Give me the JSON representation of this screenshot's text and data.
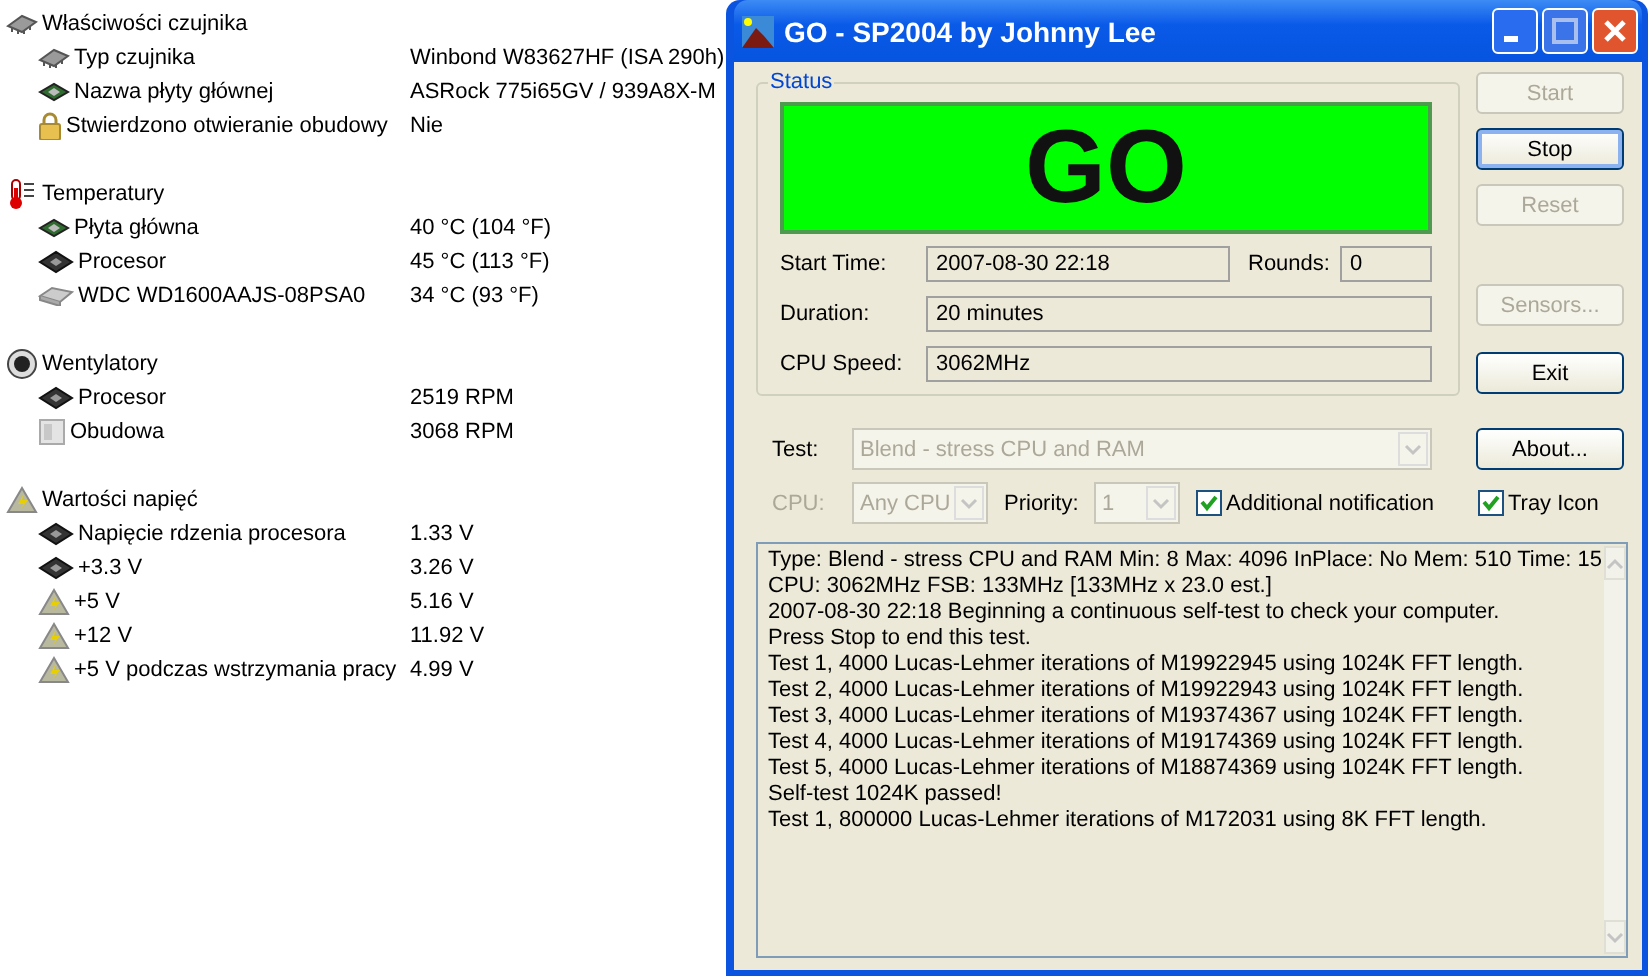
{
  "sensor_panel": {
    "sections": [
      {
        "title": "Właściwości czujnika",
        "kind": "chip",
        "items": [
          {
            "label": "Typ czujnika",
            "value": "Winbond W83627HF  (ISA 290h)",
            "kind": "chip"
          },
          {
            "label": "Nazwa płyty głównej",
            "value": "ASRock 775i65GV / 939A8X-M",
            "kind": "board"
          },
          {
            "label": "Stwierdzono otwieranie obudowy",
            "value": "Nie",
            "kind": "lock"
          }
        ]
      },
      {
        "title": "Temperatury",
        "kind": "thermo",
        "items": [
          {
            "label": "Płyta główna",
            "value": "40 °C  (104 °F)",
            "kind": "board"
          },
          {
            "label": "Procesor",
            "value": "45 °C  (113 °F)",
            "kind": "cpu"
          },
          {
            "label": "WDC WD1600AAJS-08PSA0",
            "value": "34 °C  (93 °F)",
            "kind": "disk"
          }
        ]
      },
      {
        "title": "Wentylatory",
        "kind": "fan",
        "items": [
          {
            "label": "Procesor",
            "value": "2519 RPM",
            "kind": "cpu"
          },
          {
            "label": "Obudowa",
            "value": "3068 RPM",
            "kind": "case"
          }
        ]
      },
      {
        "title": "Wartości napięć",
        "kind": "volt",
        "items": [
          {
            "label": "Napięcie rdzenia procesora",
            "value": "1.33 V",
            "kind": "cpu"
          },
          {
            "label": "+3.3 V",
            "value": "3.26 V",
            "kind": "cpu"
          },
          {
            "label": "+5 V",
            "value": "5.16 V",
            "kind": "volt"
          },
          {
            "label": "+12 V",
            "value": "11.92 V",
            "kind": "volt"
          },
          {
            "label": "+5 V podczas wstrzymania pracy",
            "value": "4.99 V",
            "kind": "volt"
          }
        ]
      }
    ]
  },
  "window": {
    "title": "GO - SP2004 by Johnny Lee",
    "status": {
      "legend": "Status",
      "indicator": "GO",
      "start_time": {
        "label": "Start Time:",
        "value": "2007-08-30 22:18"
      },
      "rounds": {
        "label": "Rounds:",
        "value": "0"
      },
      "duration": {
        "label": "Duration:",
        "value": "20 minutes"
      },
      "cpu_speed": {
        "label": "CPU Speed:",
        "value": "3062MHz"
      }
    },
    "buttons": [
      {
        "label": "Start",
        "disabled": true,
        "focused": false
      },
      {
        "label": "Stop",
        "disabled": false,
        "focused": true
      },
      {
        "label": "Reset",
        "disabled": true,
        "focused": false
      },
      {
        "label": "Sensors...",
        "disabled": true,
        "focused": false
      },
      {
        "label": "Exit",
        "disabled": false,
        "focused": false
      }
    ],
    "about_button": {
      "label": "About...",
      "disabled": false
    },
    "test": {
      "label": "Test:",
      "value": "Blend - stress CPU and RAM",
      "disabled": true
    },
    "cpu": {
      "label": "CPU:",
      "value": "Any CPU",
      "disabled": true
    },
    "priority": {
      "label": "Priority:",
      "value": "1",
      "disabled": true
    },
    "additional_notification": {
      "label": "Additional notification",
      "checked": true
    },
    "tray_icon": {
      "label": "Tray Icon",
      "checked": true
    },
    "log": [
      "Type: Blend - stress CPU and RAM Min: 8 Max: 4096 InPlace: No Mem: 510 Time: 15",
      "CPU: 3062MHz FSB: 133MHz [133MHz x 23.0 est.]",
      "2007-08-30 22:18 Beginning a continuous self-test to check your computer.",
      "Press Stop to end this test.",
      "Test 1, 4000 Lucas-Lehmer iterations of M19922945 using 1024K FFT length.",
      "Test 2, 4000 Lucas-Lehmer iterations of M19922943 using 1024K FFT length.",
      "Test 3, 4000 Lucas-Lehmer iterations of M19374367 using 1024K FFT length.",
      "Test 4, 4000 Lucas-Lehmer iterations of M19174369 using 1024K FFT length.",
      "Test 5, 4000 Lucas-Lehmer iterations of M18874369 using 1024K FFT length.",
      "Self-test 1024K passed!",
      "Test 1, 800000 Lucas-Lehmer iterations of M172031 using 8K FFT length."
    ]
  }
}
